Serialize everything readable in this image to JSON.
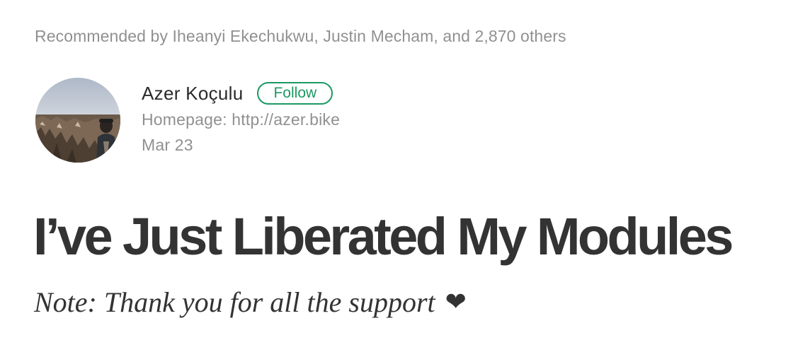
{
  "recommended": {
    "text": "Recommended by Iheanyi Ekechukwu, Justin Mecham, and 2,870 others"
  },
  "author": {
    "name": "Azer Koçulu",
    "follow_label": "Follow",
    "bio": "Homepage: http://azer.bike",
    "date": "Mar 23",
    "avatar_icon": "author-avatar-photo"
  },
  "post": {
    "title": "I’ve Just Liberated My Modules",
    "subtitle": "Note: Thank you for all the support",
    "subtitle_icon": "heart-icon"
  },
  "colors": {
    "accent": "#1c9963",
    "muted_text": "rgba(0,0,0,0.44)",
    "main_text": "rgba(0,0,0,0.84)"
  }
}
